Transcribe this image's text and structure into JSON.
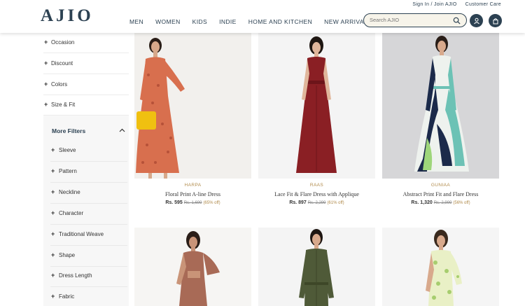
{
  "header": {
    "logo": "AJIO",
    "top_links": [
      "Sign In / Join AJIO",
      "Customer Care"
    ],
    "nav": [
      "MEN",
      "WOMEN",
      "KIDS",
      "INDIE",
      "HOME AND KITCHEN",
      "NEW ARRIVALS"
    ],
    "search_placeholder": "Search AJIO"
  },
  "sidebar": {
    "filters": [
      "Occasion",
      "Discount",
      "Colors",
      "Size & Fit"
    ],
    "more_filters_title": "More Filters",
    "more_filters": [
      "Sleeve",
      "Pattern",
      "Neckline",
      "Character",
      "Traditional Weave",
      "Shape",
      "Dress Length",
      "Fabric"
    ]
  },
  "products": [
    {
      "brand": "HARPA",
      "name": "Floral Print A-line Dress",
      "price": "Rs. 595",
      "mrp": "Rs. 1,699",
      "off": "(65% off)"
    },
    {
      "brand": "RAAS",
      "name": "Lace Fit & Flare Dress with Applique",
      "price": "Rs. 897",
      "mrp": "Rs. 2,299",
      "off": "(61% off)"
    },
    {
      "brand": "GUNIAA",
      "name": "Abstract Print Fit and Flare Dress",
      "price": "Rs. 1,320",
      "mrp": "Rs. 2,999",
      "off": "(56% off)"
    },
    {
      "brand": "",
      "name": "",
      "price": "",
      "mrp": "",
      "off": ""
    },
    {
      "brand": "",
      "name": "",
      "price": "",
      "mrp": "",
      "off": ""
    },
    {
      "brand": "",
      "name": "",
      "price": "",
      "mrp": "",
      "off": ""
    }
  ],
  "colors": {
    "brand": "#2c4152",
    "accent": "#b08a4a"
  }
}
